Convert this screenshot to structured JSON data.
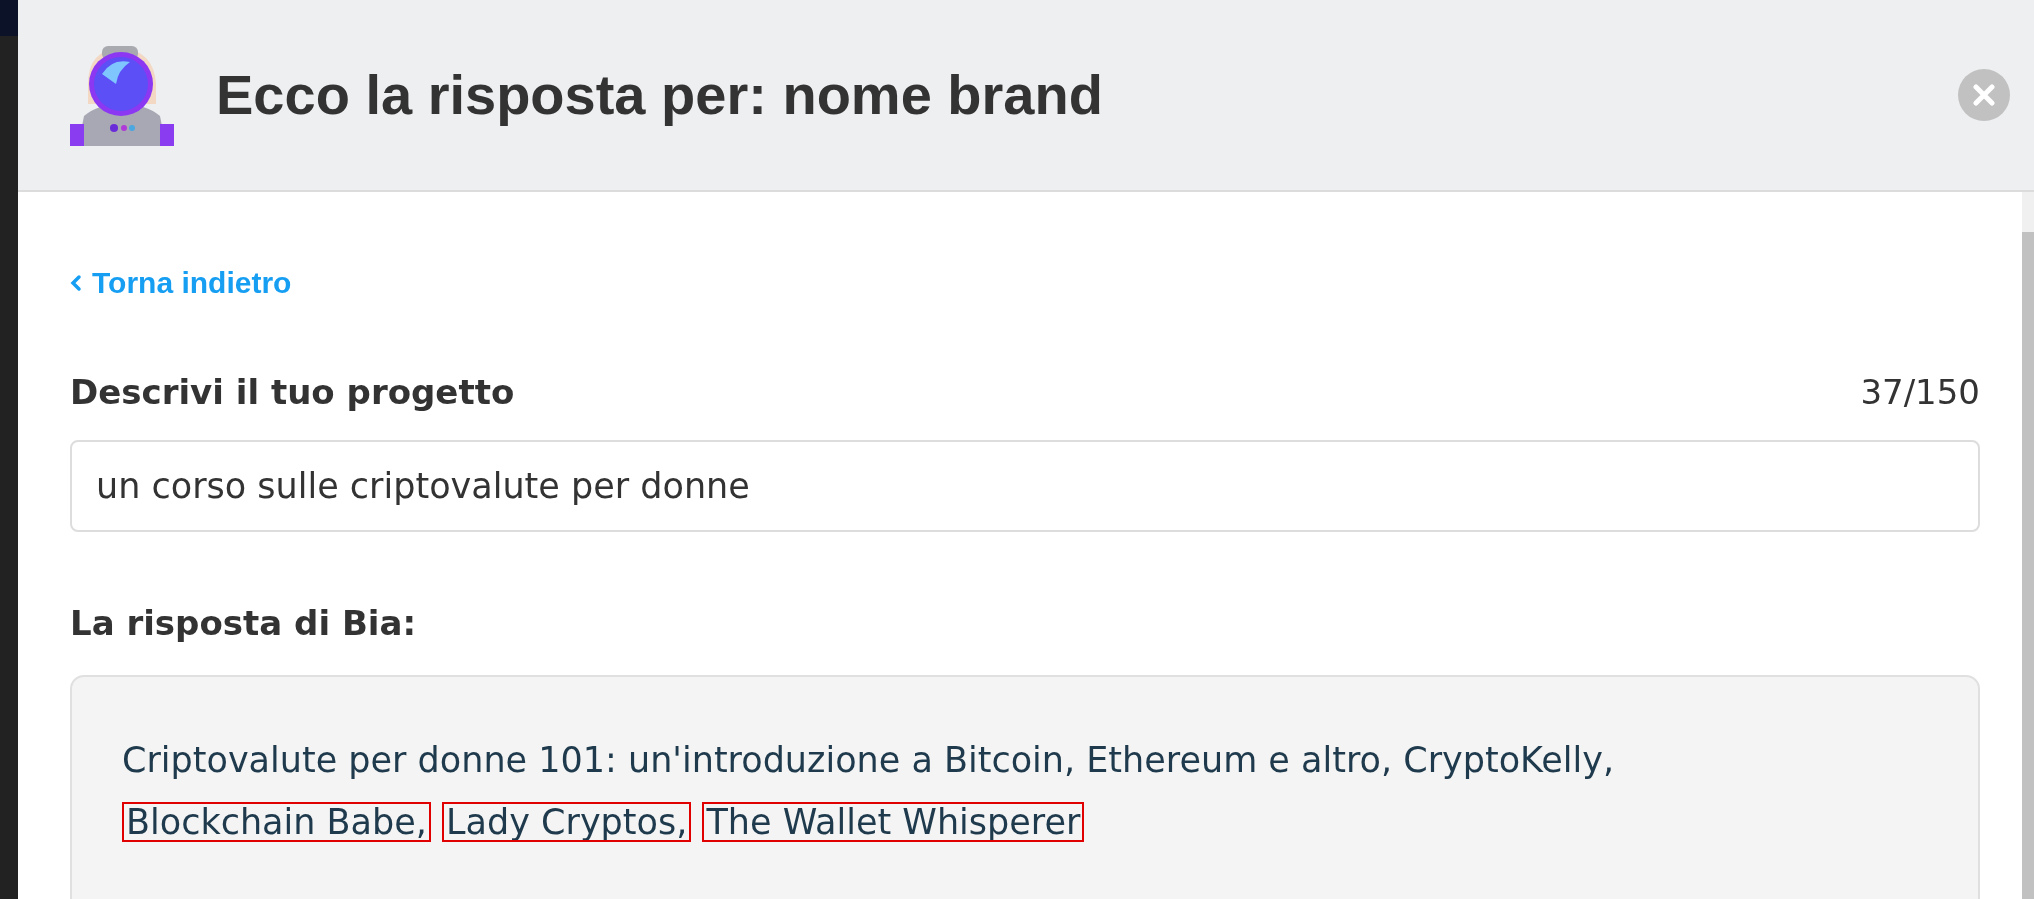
{
  "dialog": {
    "title": "Ecco la risposta per: nome brand"
  },
  "back_link": {
    "label": "Torna indietro"
  },
  "project_field": {
    "label": "Descrivi il tuo progetto",
    "counter": "37/150",
    "value": "un corso sulle criptovalute per donne"
  },
  "answer": {
    "label": "La risposta di Bia:",
    "lines": [
      [
        {
          "text": "Criptovalute per donne 101: un'introduzione a Bitcoin, Ethereum e altro, CryptoKelly,",
          "highlighted": false
        }
      ],
      [
        {
          "text": "Blockchain Babe,",
          "highlighted": true
        },
        {
          "text": "Lady Cryptos,",
          "highlighted": true
        },
        {
          "text": "The Wallet Whisperer",
          "highlighted": true
        }
      ]
    ]
  }
}
